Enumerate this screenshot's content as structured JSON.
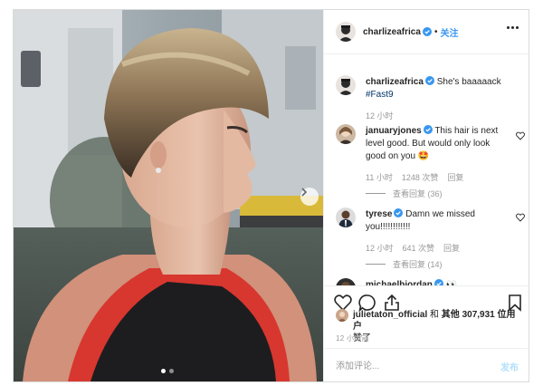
{
  "post": {
    "username": "charlizeafrica",
    "follow_label": "关注",
    "caption_text": "She's baaaaack",
    "hashtag": "#Fast9",
    "caption_time": "12 小时"
  },
  "comments": [
    {
      "username": "januaryjones",
      "text": "This hair is next level good. But would only look good on you 🤩",
      "time": "11 小时",
      "likes": "1248 次赞",
      "reply": "回复",
      "view_replies": "查看回复 (36)"
    },
    {
      "username": "tyrese",
      "text": "Damn we missed you!!!!!!!!!!!!",
      "time": "12 小时",
      "likes": "641 次赞",
      "reply": "回复",
      "view_replies": "查看回复 (14)"
    },
    {
      "username": "michaelbjordan",
      "text": "👀"
    }
  ],
  "likes": {
    "user": "julietaton_official",
    "conj": "和",
    "others": "其他 307,931 位用户",
    "suffix": "赞了"
  },
  "time_ago": "12 小时前",
  "add_comment": {
    "placeholder": "添加评论...",
    "post_label": "发布"
  },
  "icons": [
    "verified-badge-icon",
    "more-options-icon",
    "heart-icon",
    "comment-icon",
    "share-icon",
    "bookmark-icon",
    "chevron-right-icon"
  ],
  "colors": {
    "link_blue": "#3897f0",
    "hashtag_blue": "#003569",
    "muted": "#999999",
    "border": "#dbdbdb",
    "post_disabled": "#b2dffc"
  },
  "carousel": {
    "slides": 2,
    "current": 1
  }
}
